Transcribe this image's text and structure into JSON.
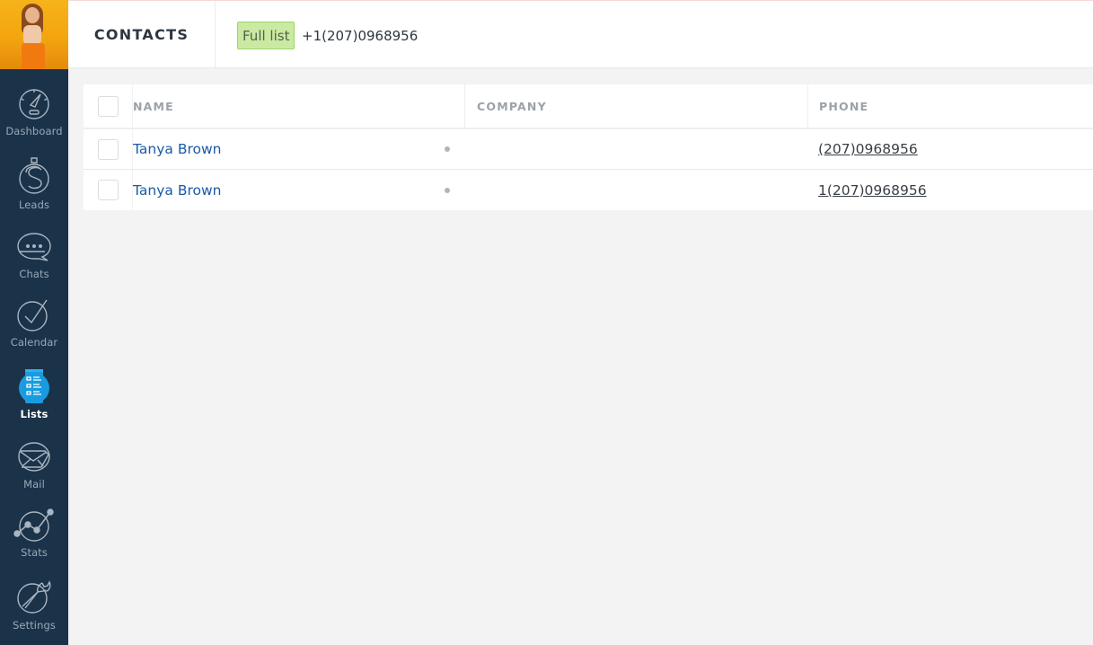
{
  "sidebar": {
    "avatar_alt": "User avatar",
    "items": [
      {
        "key": "dashboard",
        "label": "Dashboard",
        "icon": "speedometer-icon",
        "active": false
      },
      {
        "key": "leads",
        "label": "Leads",
        "icon": "dollar-icon",
        "active": false
      },
      {
        "key": "chats",
        "label": "Chats",
        "icon": "chat-bubble-icon",
        "active": false
      },
      {
        "key": "calendar",
        "label": "Calendar",
        "icon": "checkmark-circle-icon",
        "active": false
      },
      {
        "key": "lists",
        "label": "Lists",
        "icon": "list-icon",
        "active": true
      },
      {
        "key": "mail",
        "label": "Mail",
        "icon": "envelope-icon",
        "active": false
      },
      {
        "key": "stats",
        "label": "Stats",
        "icon": "line-chart-icon",
        "active": false
      },
      {
        "key": "settings",
        "label": "Settings",
        "icon": "wrench-icon",
        "active": false
      }
    ]
  },
  "header": {
    "section_title": "CONTACTS",
    "filter_tag": "Full list",
    "search_value": "+1(207)0968956"
  },
  "table": {
    "columns": {
      "name": "NAME",
      "company": "COMPANY",
      "phone": "PHONE"
    },
    "rows": [
      {
        "name": "Tanya Brown",
        "company": "",
        "phone": "(207)0968956"
      },
      {
        "name": "Tanya Brown",
        "company": "",
        "phone": "1(207)0968956"
      }
    ]
  },
  "colors": {
    "sidebar_bg": "#1a3349",
    "active_accent": "#1a9be0",
    "filter_tag_bg": "#c9eaa0",
    "name_link": "#1a5aa8"
  }
}
